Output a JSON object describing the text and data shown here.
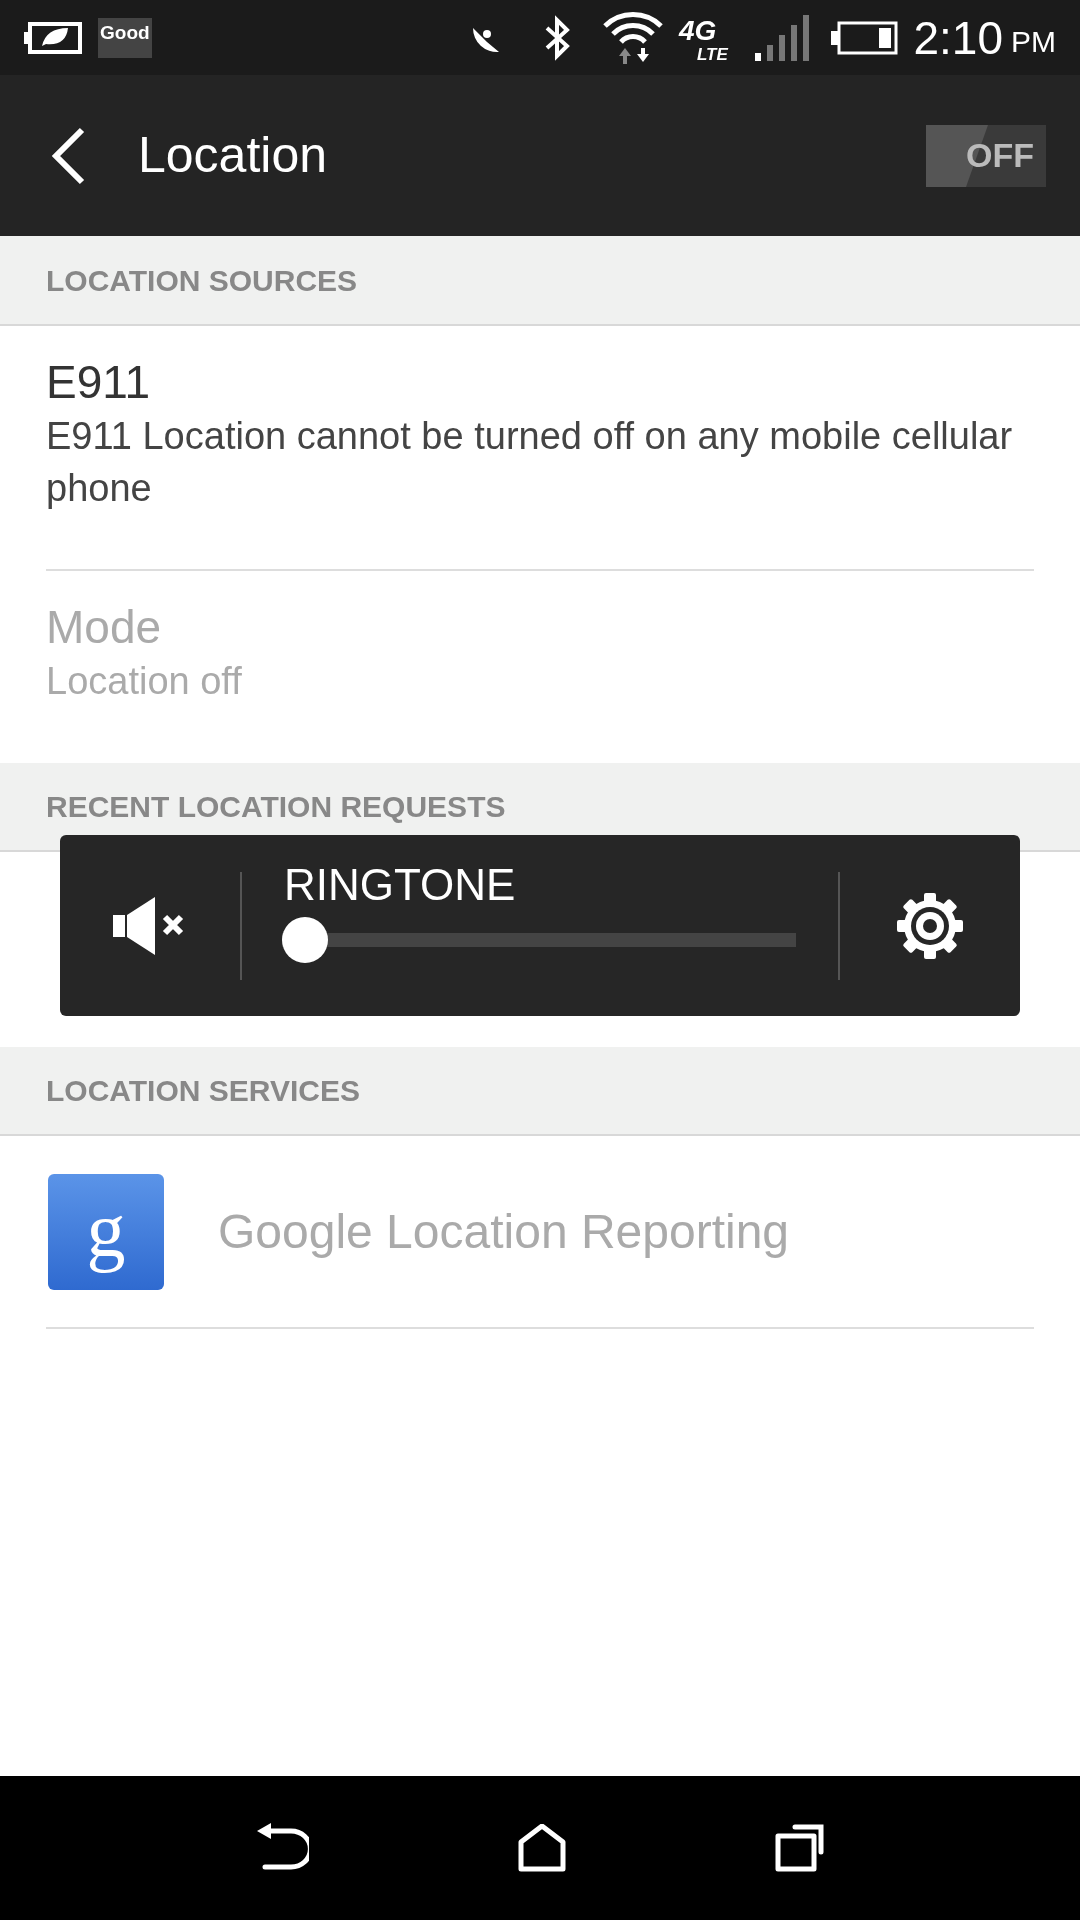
{
  "status_bar": {
    "badge": "Good",
    "network": "4G",
    "network_sub": "LTE",
    "time": "2:10",
    "ampm": "PM"
  },
  "toolbar": {
    "title": "Location",
    "switch": {
      "label": "OFF",
      "on": false
    }
  },
  "sections": [
    {
      "header": "LOCATION SOURCES",
      "items": [
        {
          "kind": "text",
          "title": "E911",
          "subtitle": "E911 Location cannot be turned off on any mobile cellular phone",
          "disabled": false
        },
        {
          "kind": "text",
          "title": "Mode",
          "subtitle": "Location off",
          "disabled": true
        }
      ]
    },
    {
      "header": "RECENT LOCATION REQUESTS"
    },
    {
      "header": "LOCATION SERVICES",
      "items": [
        {
          "kind": "app",
          "icon_letter": "g",
          "title": "Google Location Reporting",
          "disabled": true
        }
      ]
    }
  ],
  "volume_popup": {
    "label": "RINGTONE",
    "muted": true,
    "level": 0
  }
}
